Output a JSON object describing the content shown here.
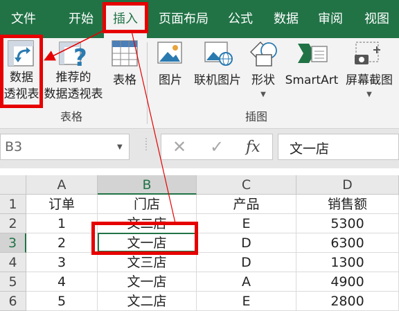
{
  "menu": {
    "tabs": [
      {
        "label": "文件"
      },
      {
        "label": "开始"
      },
      {
        "label": "插入"
      },
      {
        "label": "页面布局"
      },
      {
        "label": "公式"
      },
      {
        "label": "数据"
      },
      {
        "label": "审阅"
      },
      {
        "label": "视图"
      }
    ],
    "active_tab": "插入"
  },
  "ribbon": {
    "tables_group": {
      "label": "表格",
      "pivot_table": {
        "line1": "数据",
        "line2": "透视表"
      },
      "recommended_pivot": {
        "line1": "推荐的",
        "line2": "数据透视表"
      },
      "table": {
        "label": "表格"
      }
    },
    "illustrations_group": {
      "label": "插图",
      "pictures": {
        "label": "图片"
      },
      "online_pictures": {
        "label": "联机图片"
      },
      "shapes": {
        "label": "形状"
      },
      "smartart": {
        "label": "SmartArt"
      },
      "screenshot": {
        "label": "屏幕截图"
      }
    }
  },
  "formula_bar": {
    "name_box": "B3",
    "cancel_symbol": "✕",
    "enter_symbol": "✓",
    "fx_symbol": "fx",
    "value": "文一店"
  },
  "sheet": {
    "columns": [
      "A",
      "B",
      "C",
      "D"
    ],
    "rows": [
      "1",
      "2",
      "3",
      "4",
      "5",
      "6"
    ],
    "selected_column": "B",
    "selected_row": "3",
    "cells": [
      [
        "订单",
        "门店",
        "产品",
        "销售额"
      ],
      [
        "1",
        "文二店",
        "E",
        "5300"
      ],
      [
        "2",
        "文一店",
        "D",
        "6300"
      ],
      [
        "3",
        "文三店",
        "D",
        "1300"
      ],
      [
        "4",
        "文一店",
        "A",
        "4900"
      ],
      [
        "5",
        "文二店",
        "E",
        "2800"
      ]
    ]
  },
  "colors": {
    "excel_green": "#217346",
    "annotation_red": "#e60000"
  }
}
